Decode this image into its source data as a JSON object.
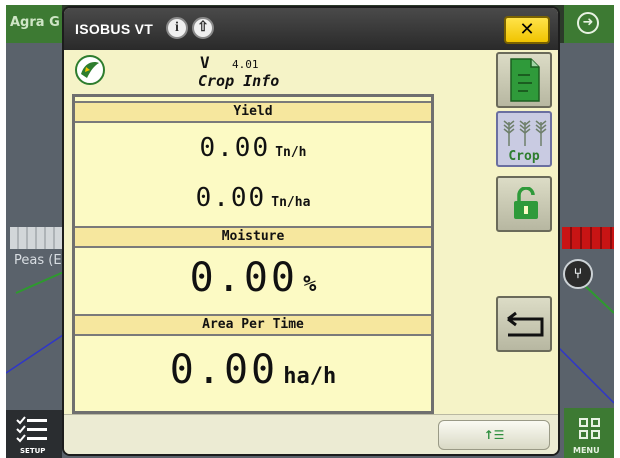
{
  "background": {
    "app_label": "Agra G",
    "left_field_label": "Peas (E",
    "setup_label": "SETUP",
    "menu_label": "MENU"
  },
  "dialog": {
    "title": "ISOBUS VT",
    "version_prefix": "V",
    "version": "4.01",
    "screen_title": "Crop Info",
    "sections": {
      "yield": {
        "header": "Yield",
        "rate_value": "0.00",
        "rate_unit": "Tn/h",
        "area_value": "0.00",
        "area_unit": "Tn/ha"
      },
      "moisture": {
        "header": "Moisture",
        "value": "0.00",
        "unit": "%"
      },
      "area_per_time": {
        "header": "Area Per Time",
        "value": "0.00",
        "unit": "ha/h"
      }
    },
    "softkeys": {
      "crop_label": "Crop"
    },
    "icons": {
      "close": "close-icon",
      "info": "info-icon",
      "nav": "up-arrow-icon",
      "document": "document-icon",
      "crop": "crop-icon",
      "lock": "unlock-icon",
      "back": "return-arrow-icon"
    },
    "colors": {
      "dialog_bg": "#f5f3c7",
      "header_bg": "#f6e79e",
      "close_yellow": "#f0c400",
      "accent_green": "#2e7d2e"
    }
  }
}
